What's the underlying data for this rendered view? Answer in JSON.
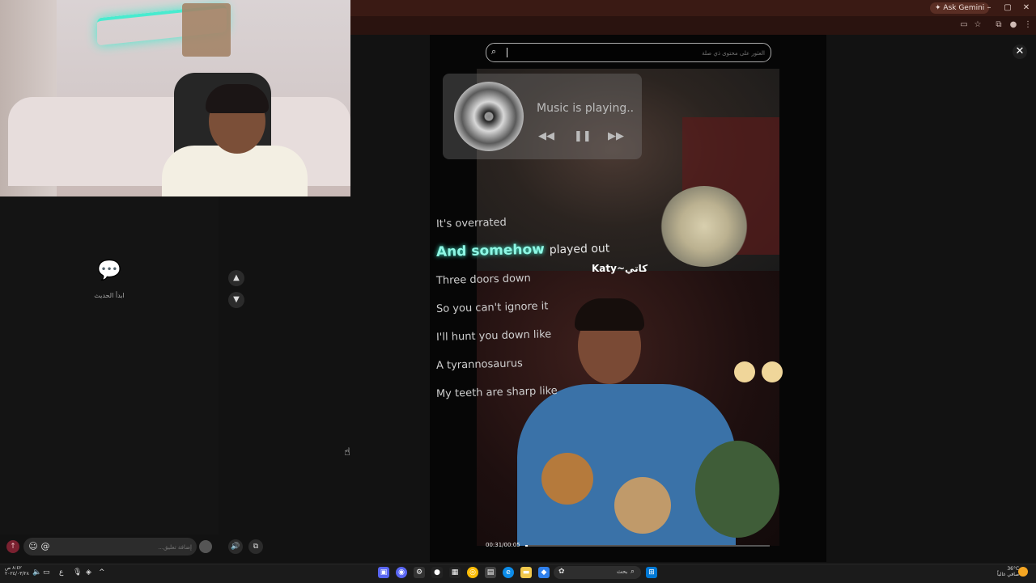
{
  "browser": {
    "ask_gemini": "Ask Gemini",
    "window_buttons": [
      "–",
      "▢",
      "✕"
    ],
    "toolbar_icons": [
      "cast-icon",
      "star-icon",
      "extension-icon",
      "profile-icon",
      "menu-icon"
    ]
  },
  "chat": {
    "empty_text": "ابدأ الحديث",
    "input_placeholder": "إضافة تعليق...",
    "emoji_icon": "☺",
    "mention_icon": "@"
  },
  "video": {
    "search_placeholder": "العثور على محتوى ذي صلة",
    "music_status": "Music is playing..",
    "lyrics": [
      "It's overrated",
      "And somehow",
      "played out",
      "Three doors down",
      "So you can't ignore it",
      "I'll hunt you down like",
      "A tyrannosaurus",
      "My teeth are sharp like"
    ],
    "watermark": "Katy~كاتي",
    "time": "00:31/00:05",
    "progress": 0.01
  },
  "taskbar": {
    "clock_time": "٨:٤٢ ص",
    "clock_date": "٢٠٢٤/٠٣/٢٨",
    "lang": "ع",
    "search_text": "بحث",
    "weather_temp": "36°C",
    "weather_desc": "صافي غالباً"
  },
  "colors": {
    "lyric_highlight": "#8ef7e4",
    "send_button": "#7a2130",
    "browser_bar": "#3a1a14"
  }
}
